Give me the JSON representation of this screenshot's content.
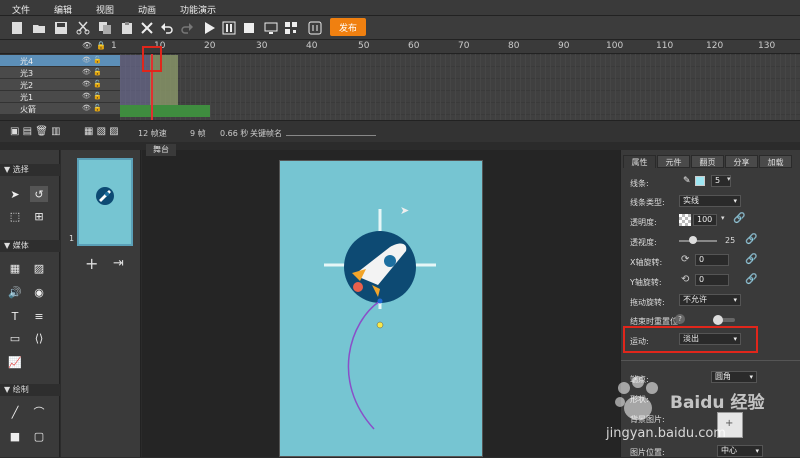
{
  "menu": [
    "文件",
    "编辑",
    "视图",
    "动画",
    "功能演示"
  ],
  "toolbar": {
    "publish_label": "发布"
  },
  "timeline": {
    "ruler": [
      "1",
      "10",
      "20",
      "30",
      "40",
      "50",
      "60",
      "70",
      "80",
      "90",
      "100",
      "110",
      "120",
      "130"
    ],
    "layers": [
      "光4",
      "光3",
      "光2",
      "光1",
      "火箭"
    ],
    "status": {
      "fps": "12 帧速",
      "frames": "9 帧",
      "seconds": "0.66 秒",
      "keyframe_label": "关键帧名"
    }
  },
  "tools": {
    "select_header": "选择",
    "media_header": "媒体",
    "draw_header": "绘制"
  },
  "pages": {
    "page_number": "1"
  },
  "stage": {
    "tab": "舞台"
  },
  "props": {
    "tabs": [
      "属性",
      "元件",
      "翻页",
      "分享",
      "加载"
    ],
    "line_label": "线条:",
    "line_width": "5",
    "line_type_label": "线条类型:",
    "line_type_value": "实线",
    "opacity_label": "透明度:",
    "opacity_value": "100",
    "blur_label": "透视度:",
    "blur_value": "25",
    "x_rotate_label": "X轴旋转:",
    "x_rotate_value": "0",
    "y_rotate_label": "Y轴旋转:",
    "y_rotate_value": "0",
    "drag_rotate_label": "拖动旋转:",
    "drag_rotate_value": "不允许",
    "reset_label": "结束时重置位:",
    "motion_label": "运动:",
    "motion_value": "淡出",
    "endpoint_label": "端点:",
    "endpoint_value": "圆角",
    "shape_label": "形状:",
    "bg_label": "背景图片:",
    "img_pos_label": "图片位置:",
    "img_pos_value": "中心"
  },
  "watermark": {
    "brand": "Baidu 经验",
    "url": "jingyan.baidu.com"
  },
  "colors": {
    "accent": "#f08010",
    "canvas": "#76c5d2",
    "highlight": "#e0261b",
    "selected_layer": "#5c8fb8"
  }
}
